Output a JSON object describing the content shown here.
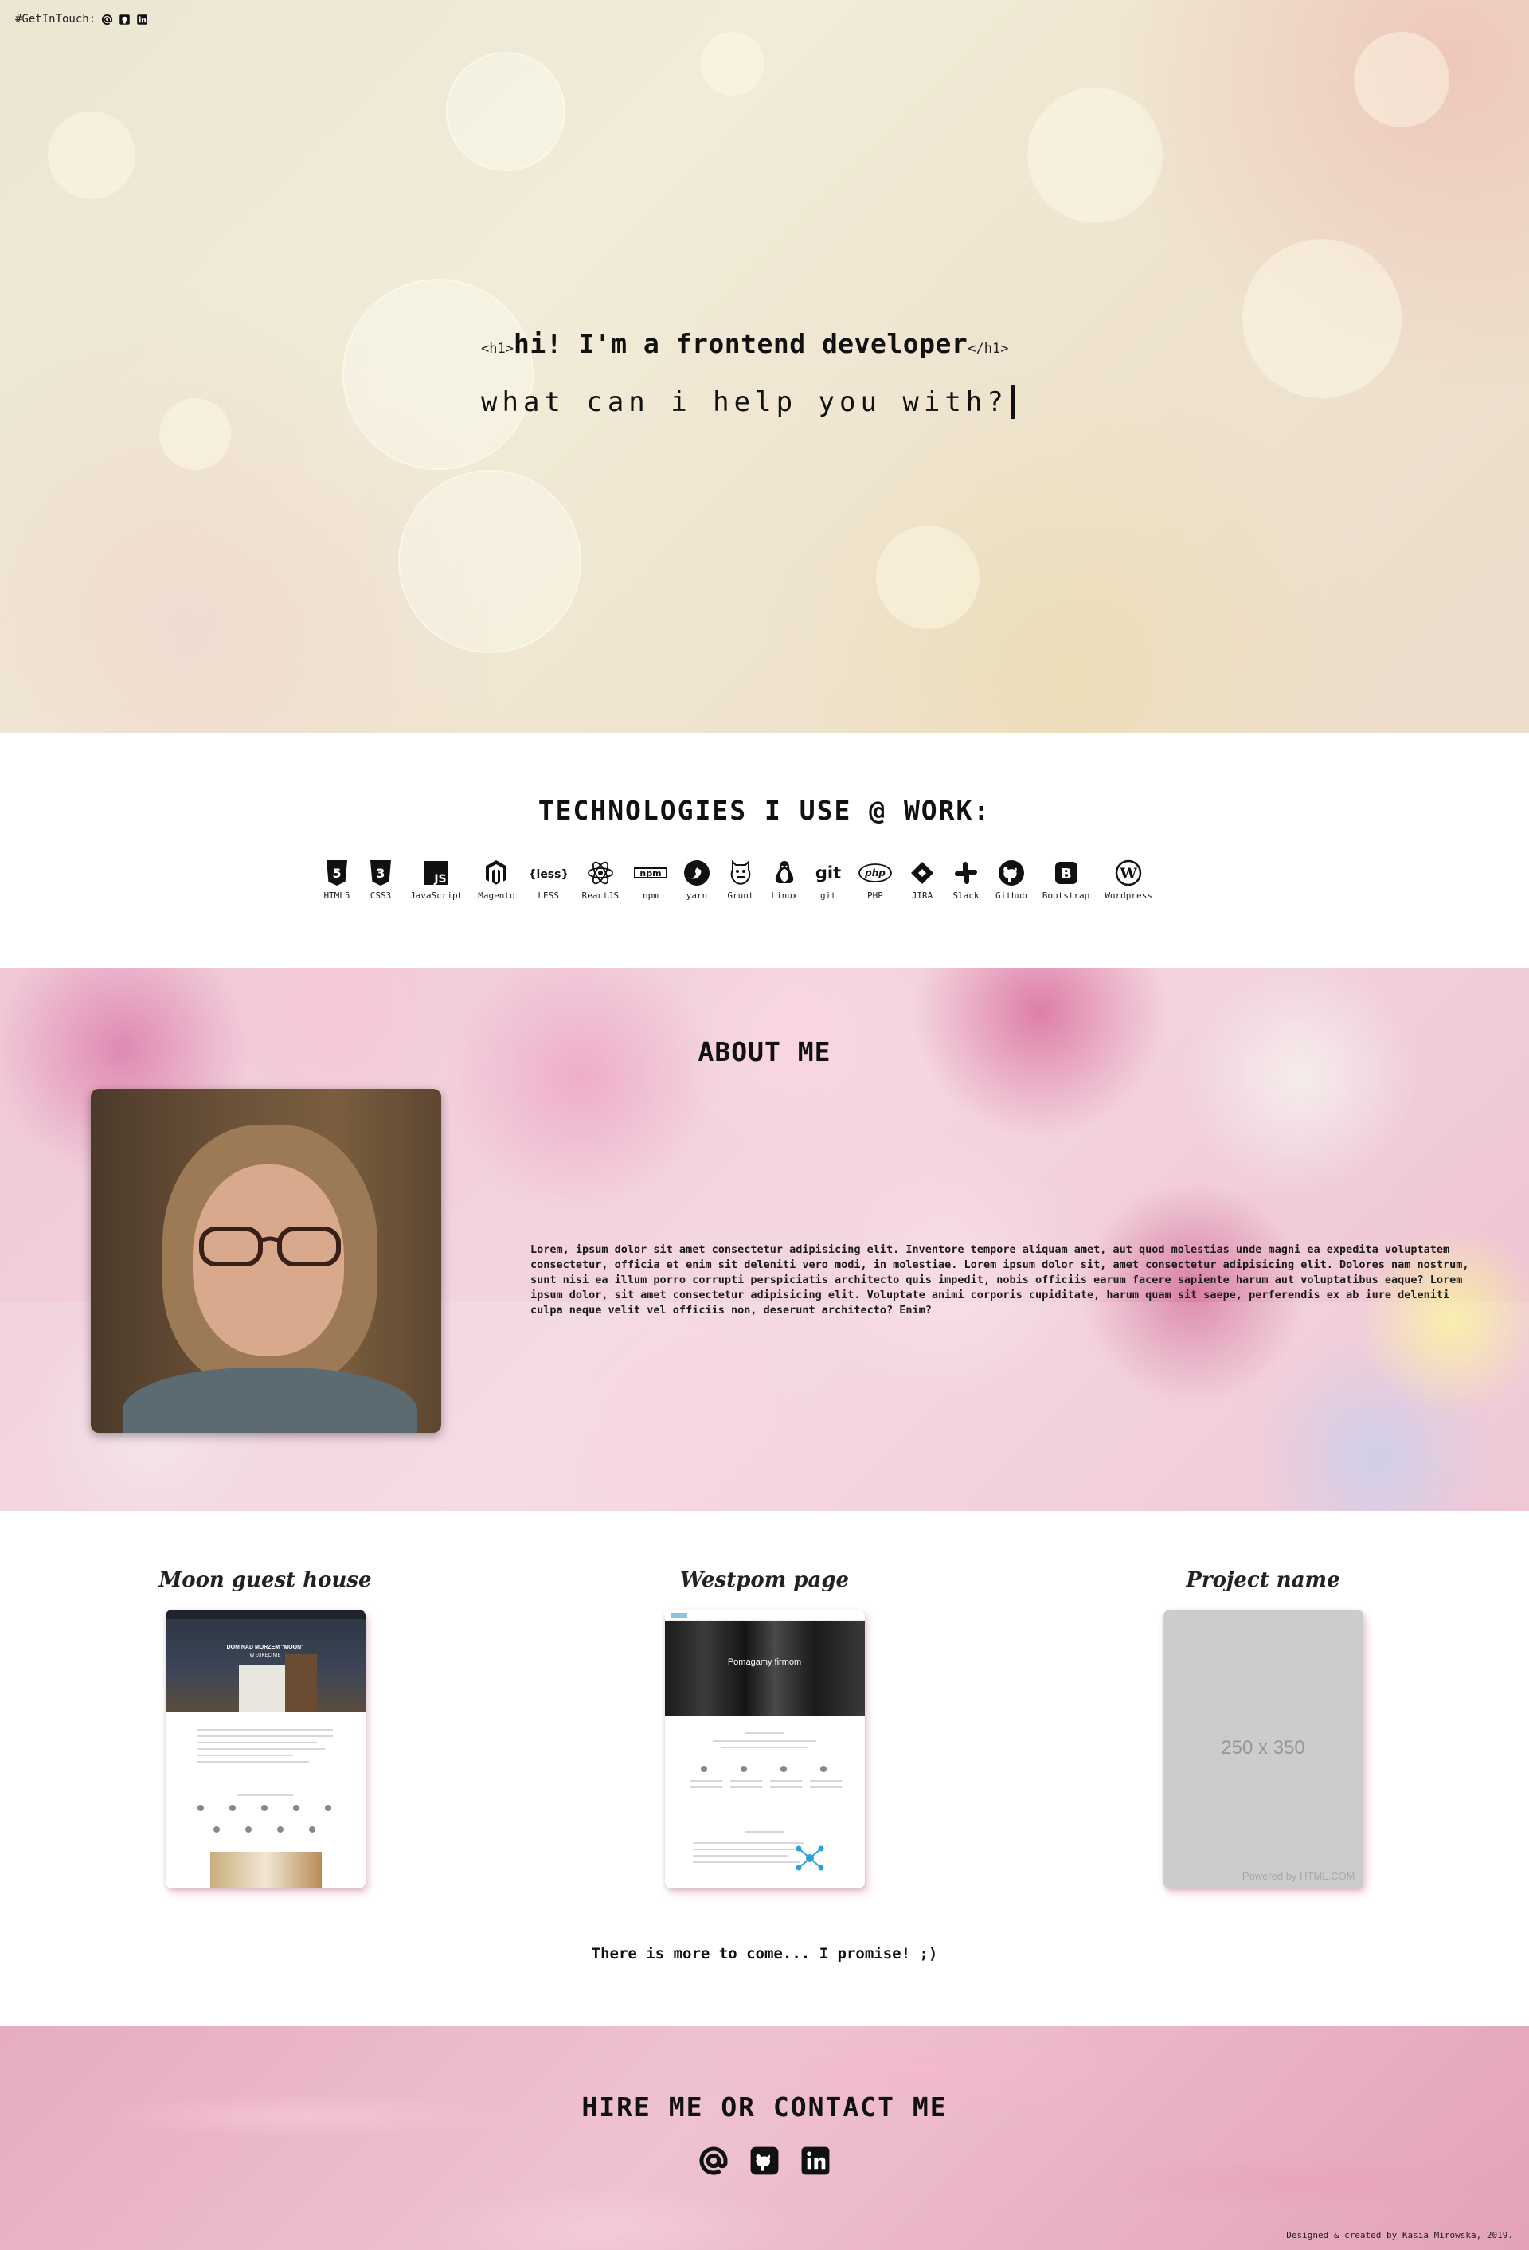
{
  "header": {
    "get_in_touch": "#GetInTouch:",
    "links": [
      {
        "icon": "at-icon"
      },
      {
        "icon": "github-icon"
      },
      {
        "icon": "linkedin-icon"
      }
    ]
  },
  "hero": {
    "open_tag": "<h1>",
    "title": "hi! I'm a frontend developer",
    "close_tag": "</h1>",
    "subtitle": "what can i help you with?"
  },
  "technologies": {
    "title": "TECHNOLOGIES I USE @ WORK:",
    "items": [
      {
        "label": "HTML5",
        "icon": "html5-icon"
      },
      {
        "label": "CSS3",
        "icon": "css3-icon"
      },
      {
        "label": "JavaScript",
        "icon": "javascript-icon"
      },
      {
        "label": "Magento",
        "icon": "magento-icon"
      },
      {
        "label": "LESS",
        "icon": "less-icon"
      },
      {
        "label": "ReactJS",
        "icon": "react-icon"
      },
      {
        "label": "npm",
        "icon": "npm-icon"
      },
      {
        "label": "yarn",
        "icon": "yarn-icon"
      },
      {
        "label": "Grunt",
        "icon": "grunt-icon"
      },
      {
        "label": "Linux",
        "icon": "linux-icon"
      },
      {
        "label": "git",
        "icon": "git-icon"
      },
      {
        "label": "PHP",
        "icon": "php-icon"
      },
      {
        "label": "JIRA",
        "icon": "jira-icon"
      },
      {
        "label": "Slack",
        "icon": "slack-icon"
      },
      {
        "label": "Github",
        "icon": "github-icon"
      },
      {
        "label": "Bootstrap",
        "icon": "bootstrap-icon"
      },
      {
        "label": "Wordpress",
        "icon": "wordpress-icon"
      }
    ]
  },
  "about": {
    "title": "ABOUT ME",
    "text": "Lorem, ipsum dolor sit amet consectetur adipisicing elit. Inventore tempore aliquam amet, aut quod molestias unde magni ea expedita voluptatem consectetur, officia et enim sit deleniti vero modi, in molestiae. Lorem ipsum dolor sit, amet consectetur adipisicing elit. Dolores nam nostrum, sunt nisi ea illum porro corrupti perspiciatis architecto quis impedit, nobis officiis earum facere sapiente harum aut voluptatibus eaque? Lorem ipsum dolor, sit amet consectetur adipisicing elit. Voluptate animi corporis cupiditate, harum quam sit saepe, perferendis ex ab iure deleniti culpa neque velit vel officiis non, deserunt architecto? Enim?"
  },
  "projects": {
    "items": [
      {
        "title": "Moon guest house",
        "hero_text": "DOM NAD MORZEM \"MOON\"",
        "hero_sub": "W ŁUKĘCINIE"
      },
      {
        "title": "Westpom page",
        "hero_text": "Pomagamy firmom"
      },
      {
        "title": "Project name",
        "placeholder": "250 x 350",
        "credit": "Powered by HTML.COM"
      }
    ],
    "more": "There is more to come... I promise! ;)"
  },
  "contact": {
    "title": "HIRE ME OR CONTACT ME",
    "icons": [
      "at-icon",
      "github-icon",
      "linkedin-icon"
    ],
    "credit": "Designed & created by Kasia Mirowska, 2019."
  },
  "colors": {
    "accent_pink": "#e6adc0",
    "text": "#111111"
  }
}
